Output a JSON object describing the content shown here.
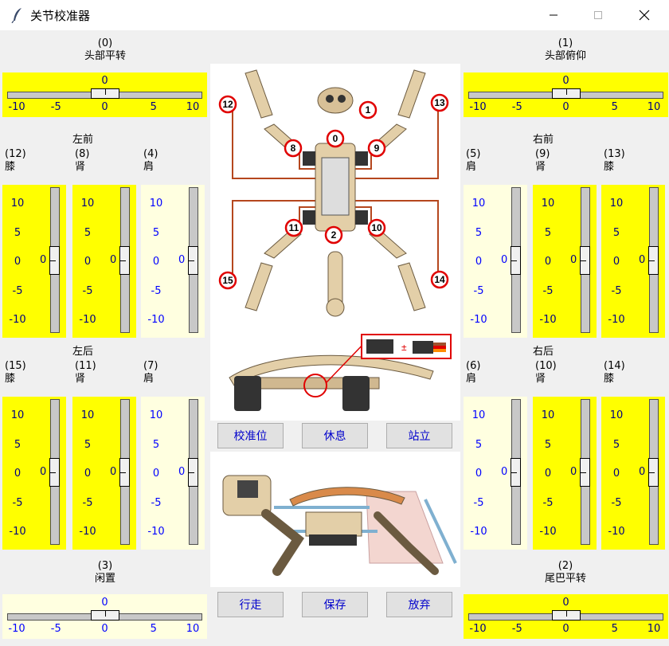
{
  "window": {
    "title": "关节校准器"
  },
  "colors": {
    "active": "#ffff00",
    "inactive": "#ffffe0",
    "active_text": "#000080",
    "inactive_text": "#0000ff",
    "button_text": "#0000cc",
    "wire": "#b5471e"
  },
  "top_joints": {
    "head_pan": {
      "index": "(0)",
      "name": "头部平转",
      "value": "0",
      "ticks": [
        "-10",
        "-5",
        "0",
        "5",
        "10"
      ]
    },
    "head_tilt": {
      "index": "(1)",
      "name": "头部俯仰",
      "value": "0",
      "ticks": [
        "-10",
        "-5",
        "0",
        "5",
        "10"
      ]
    }
  },
  "bottom_joints": {
    "idle": {
      "index": "(3)",
      "name": "闲置",
      "value": "0",
      "ticks": [
        "-10",
        "-5",
        "0",
        "5",
        "10"
      ]
    },
    "tail_pan": {
      "index": "(2)",
      "name": "尾巴平转",
      "value": "0",
      "ticks": [
        "-10",
        "-5",
        "0",
        "5",
        "10"
      ]
    }
  },
  "groups": {
    "left_front": {
      "title": "左前",
      "joints": [
        {
          "index": "(12)",
          "name": "膝",
          "value": "0",
          "ticks": [
            "10",
            "5",
            "0",
            "-5",
            "-10"
          ]
        },
        {
          "index": "(8)",
          "name": "肾",
          "value": "0",
          "ticks": [
            "10",
            "5",
            "0",
            "-5",
            "-10"
          ]
        },
        {
          "index": "(4)",
          "name": "肩",
          "value": "0",
          "ticks": [
            "10",
            "5",
            "0",
            "-5",
            "-10"
          ]
        }
      ]
    },
    "right_front": {
      "title": "右前",
      "joints": [
        {
          "index": "(5)",
          "name": "肩",
          "value": "0",
          "ticks": [
            "10",
            "5",
            "0",
            "-5",
            "-10"
          ]
        },
        {
          "index": "(9)",
          "name": "肾",
          "value": "0",
          "ticks": [
            "10",
            "5",
            "0",
            "-5",
            "-10"
          ]
        },
        {
          "index": "(13)",
          "name": "膝",
          "value": "0",
          "ticks": [
            "10",
            "5",
            "0",
            "-5",
            "-10"
          ]
        }
      ]
    },
    "left_back": {
      "title": "左后",
      "joints": [
        {
          "index": "(15)",
          "name": "膝",
          "value": "0",
          "ticks": [
            "10",
            "5",
            "0",
            "-5",
            "-10"
          ]
        },
        {
          "index": "(11)",
          "name": "肾",
          "value": "0",
          "ticks": [
            "10",
            "5",
            "0",
            "-5",
            "-10"
          ]
        },
        {
          "index": "(7)",
          "name": "肩",
          "value": "0",
          "ticks": [
            "10",
            "5",
            "0",
            "-5",
            "-10"
          ]
        }
      ]
    },
    "right_back": {
      "title": "右后",
      "joints": [
        {
          "index": "(6)",
          "name": "肩",
          "value": "0",
          "ticks": [
            "10",
            "5",
            "0",
            "-5",
            "-10"
          ]
        },
        {
          "index": "(10)",
          "name": "肾",
          "value": "0",
          "ticks": [
            "10",
            "5",
            "0",
            "-5",
            "-10"
          ]
        },
        {
          "index": "(14)",
          "name": "膝",
          "value": "0",
          "ticks": [
            "10",
            "5",
            "0",
            "-5",
            "-10"
          ]
        }
      ]
    }
  },
  "diagram": {
    "markers": [
      "0",
      "1",
      "2",
      "8",
      "9",
      "10",
      "11",
      "12",
      "13",
      "14",
      "15"
    ]
  },
  "buttons": {
    "calibrate": "校准位",
    "rest": "休息",
    "stand": "站立",
    "walk": "行走",
    "save": "保存",
    "abandon": "放弃"
  }
}
